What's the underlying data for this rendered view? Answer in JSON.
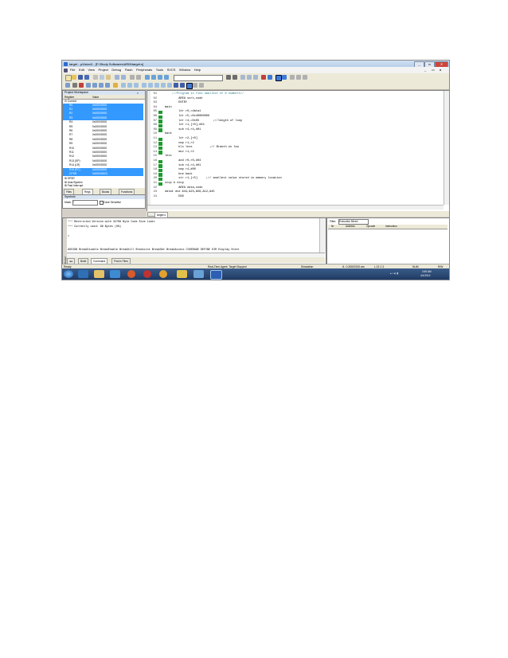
{
  "window": {
    "title": "target - µVision3 - [F:\\Study Softwares\\ARM\\target.s]"
  },
  "title_buttons": [
    "_",
    "▭",
    "✕"
  ],
  "menus": [
    "File",
    "Edit",
    "View",
    "Project",
    "Debug",
    "Flash",
    "Peripherals",
    "Tools",
    "SVCS",
    "Window",
    "Help"
  ],
  "mdi_buttons": [
    "_",
    "▭",
    "x"
  ],
  "project_workspace": {
    "title": "Project Workspace",
    "columns": [
      "Register",
      "Value"
    ],
    "group": "Current",
    "registers": [
      {
        "name": "R0",
        "value": "0x00000000",
        "selected": true
      },
      {
        "name": "R1",
        "value": "0x00000000",
        "selected": true
      },
      {
        "name": "R2",
        "value": "0x00000000",
        "selected": true
      },
      {
        "name": "R3",
        "value": "0x00000000",
        "selected": true
      },
      {
        "name": "R4",
        "value": "0x00000000",
        "selected": false
      },
      {
        "name": "R5",
        "value": "0x00000000",
        "selected": false
      },
      {
        "name": "R6",
        "value": "0x00000000",
        "selected": false
      },
      {
        "name": "R7",
        "value": "0x00000000",
        "selected": false
      },
      {
        "name": "R8",
        "value": "0x00000000",
        "selected": false
      },
      {
        "name": "R9",
        "value": "0x00000000",
        "selected": false
      },
      {
        "name": "R10",
        "value": "0x00000000",
        "selected": false
      },
      {
        "name": "R11",
        "value": "0x00000000",
        "selected": false
      },
      {
        "name": "R12",
        "value": "0x00000000",
        "selected": false
      },
      {
        "name": "R13 (SP)",
        "value": "0x00000000",
        "selected": false
      },
      {
        "name": "R14 (LR)",
        "value": "0x00000000",
        "selected": false
      },
      {
        "name": "R15 (PC)",
        "value": "0x00000000",
        "selected": true
      },
      {
        "name": "CPSR",
        "value": "0x000000D3",
        "selected": true
      }
    ],
    "tree_items": [
      "SPSR",
      "User/System",
      "Fast Interrupt"
    ],
    "tabs": [
      "Files",
      "Regs",
      "Books",
      "Functions"
    ]
  },
  "symbols": {
    "title": "Symbols",
    "mask_label": "Mask:",
    "mask_value": "*",
    "case_label": "Case Sensitive"
  },
  "editor": {
    "tab": "target.s",
    "lines": [
      {
        "no": "01",
        "text": "    ;//Program to find smallest of N numbers//",
        "mark": false
      },
      {
        "no": "02",
        "text": "        AREA sort,code",
        "mark": false
      },
      {
        "no": "03",
        "text": "        ENTRY",
        "mark": false
      },
      {
        "no": "04",
        "text": "main",
        "mark": false
      },
      {
        "no": "05",
        "text": "        ldr r0,=data1",
        "mark": true
      },
      {
        "no": "06",
        "text": "        ldr r5,=0x40000000",
        "mark": true
      },
      {
        "no": "07",
        "text": "        ldr r4,=0x05        ;//length of loop",
        "mark": true
      },
      {
        "no": "08",
        "text": "        ldr r1,[r0],#04",
        "mark": true
      },
      {
        "no": "09",
        "text": "        sub r4,r4,#01",
        "mark": true
      },
      {
        "no": "10",
        "text": "back",
        "mark": false
      },
      {
        "no": "11",
        "text": "        ldr r2,[r0]",
        "mark": true
      },
      {
        "no": "12",
        "text": "        cmp r1,r2",
        "mark": true
      },
      {
        "no": "13",
        "text": "        bls less          ;// Branch on low",
        "mark": true
      },
      {
        "no": "14",
        "text": "        mov r1,r2",
        "mark": true
      },
      {
        "no": "15",
        "text": "less",
        "mark": false
      },
      {
        "no": "16",
        "text": "        add r0,r0,#04",
        "mark": true
      },
      {
        "no": "17",
        "text": "        sub r4,r4,#01",
        "mark": true
      },
      {
        "no": "18",
        "text": "        cmp r4,#00",
        "mark": true
      },
      {
        "no": "19",
        "text": "        bne back",
        "mark": true
      },
      {
        "no": "20",
        "text": "        str r1,[r5]     ;// smallest value stored in memory location",
        "mark": true
      },
      {
        "no": "21",
        "text": "stop b stop",
        "mark": true
      },
      {
        "no": "22",
        "text": "        AREA data,code",
        "mark": false
      },
      {
        "no": "23",
        "text": "data1 dcd &44,&23,&56,&12,&45",
        "mark": false
      },
      {
        "no": "24",
        "text": "        END",
        "mark": false
      }
    ]
  },
  "command": {
    "lines": [
      "*** Restricted Version with 32768 Byte Code Size Limit",
      "*** Currently used: 96 Bytes (0%)",
      "",
      ">",
      "ASSIGN BreakDisable BreakEnable BreakKill BreakList BreakSet BreakAccess COVERAGE DEFINE DIR Display Enter"
    ],
    "side_label": "Output Window",
    "tabs": [
      "Build",
      "Command",
      "Find in Files"
    ]
  },
  "perf": {
    "filter_label": "Filter:",
    "filter_value": "Execution Mixed",
    "columns": [
      "Nr",
      "Address",
      "Opcode",
      "Instruction"
    ]
  },
  "status": {
    "ready": "Ready",
    "agent": "Real-Time Agent: Target Stopped",
    "mode": "Simulation",
    "time": "t1: 0.26507625 sec",
    "pos": "L:21 C:1",
    "num": "NUM",
    "rw": "R/W"
  },
  "taskbar": {
    "time": "3:45 AM",
    "date": "4/1/2013"
  },
  "colors": {
    "selection": "#3399ff",
    "green_marker": "#1e9b2e",
    "taskbar": "#1f3a63"
  }
}
